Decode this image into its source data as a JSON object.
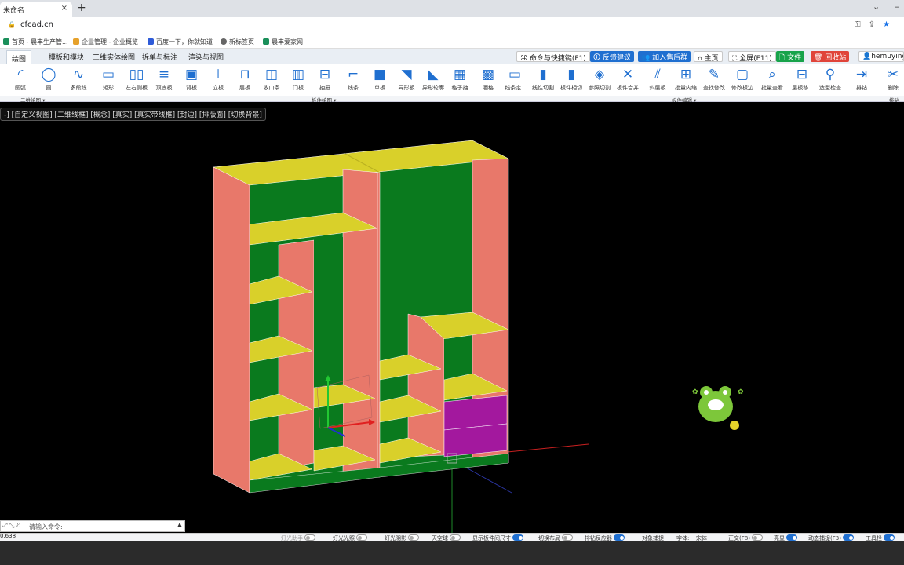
{
  "browser": {
    "tab_title": "未命名",
    "tab_close": "×",
    "new_tab": "+",
    "url": "cfcad.cn",
    "bookmarks": [
      "首页 - 晨丰生产管...",
      "企业管理 - 企业概览",
      "百度一下，你就知道",
      "新标签页",
      "晨丰爱家网"
    ]
  },
  "menu": {
    "tabs": [
      "绘图",
      "模板和模块",
      "三维实体绘图",
      "拆单与标注",
      "渲染与视图"
    ],
    "buttons": {
      "commands": "命令与快捷键(F1)",
      "feedback": "反馈建议",
      "aftersales": "加入售后群",
      "home": "主页",
      "fullscreen": "全屏(F11)",
      "file": "文件",
      "recycle": "回收站",
      "user": "hemuying"
    }
  },
  "toolbar": {
    "tools": [
      "圆弧",
      "圆",
      "多段线",
      "矩形",
      "左右侧板",
      "顶底板",
      "背板",
      "立板",
      "层板",
      "收口条",
      "门板",
      "抽屉",
      "线条",
      "单板",
      "异形板",
      "异形轮廓",
      "格子抽",
      "酒格",
      "线条定..",
      "线性切割",
      "板件相切",
      "参照切割",
      "板件合并",
      "斜层板",
      "批量内缩",
      "查找修改",
      "修改板边",
      "批量查看",
      "层板移..",
      "造型检查",
      "排钻",
      "删除"
    ],
    "groups": [
      "二维绘图",
      "板件绘图",
      "板件编辑",
      "排钻"
    ]
  },
  "viewport": {
    "view_modes": "-] [自定义视图] [二维线框] [概念] [真实] [真实带线框] [封边] [排版面] [切换背景]"
  },
  "command": {
    "placeholder": "请输入命令:"
  },
  "status": {
    "coord": "0.638",
    "items": [
      {
        "label": "灯光助手",
        "on": false
      },
      {
        "label": "灯光光照",
        "on": false
      },
      {
        "label": "灯光阴影",
        "on": false
      },
      {
        "label": "天空球",
        "on": false
      },
      {
        "label": "显示板件间尺寸",
        "on": true
      },
      {
        "label": "切换布局",
        "on": false
      },
      {
        "label": "排钻反应器",
        "on": true
      },
      {
        "label": "对象捕捉",
        "on": null
      },
      {
        "label": "字体:",
        "on": null
      },
      {
        "label": "宋体",
        "on": null
      },
      {
        "label": "正交(F8)",
        "on": false
      },
      {
        "label": "亮显",
        "on": true
      },
      {
        "label": "动态捕捉(F3)",
        "on": true
      },
      {
        "label": "工具栏",
        "on": true
      }
    ]
  },
  "colors": {
    "panel_side": "#e8786a",
    "panel_shelf": "#d9d02a",
    "panel_back": "#0a7a1e",
    "drawer": "#a3189e",
    "accent": "#1f6fd0"
  }
}
